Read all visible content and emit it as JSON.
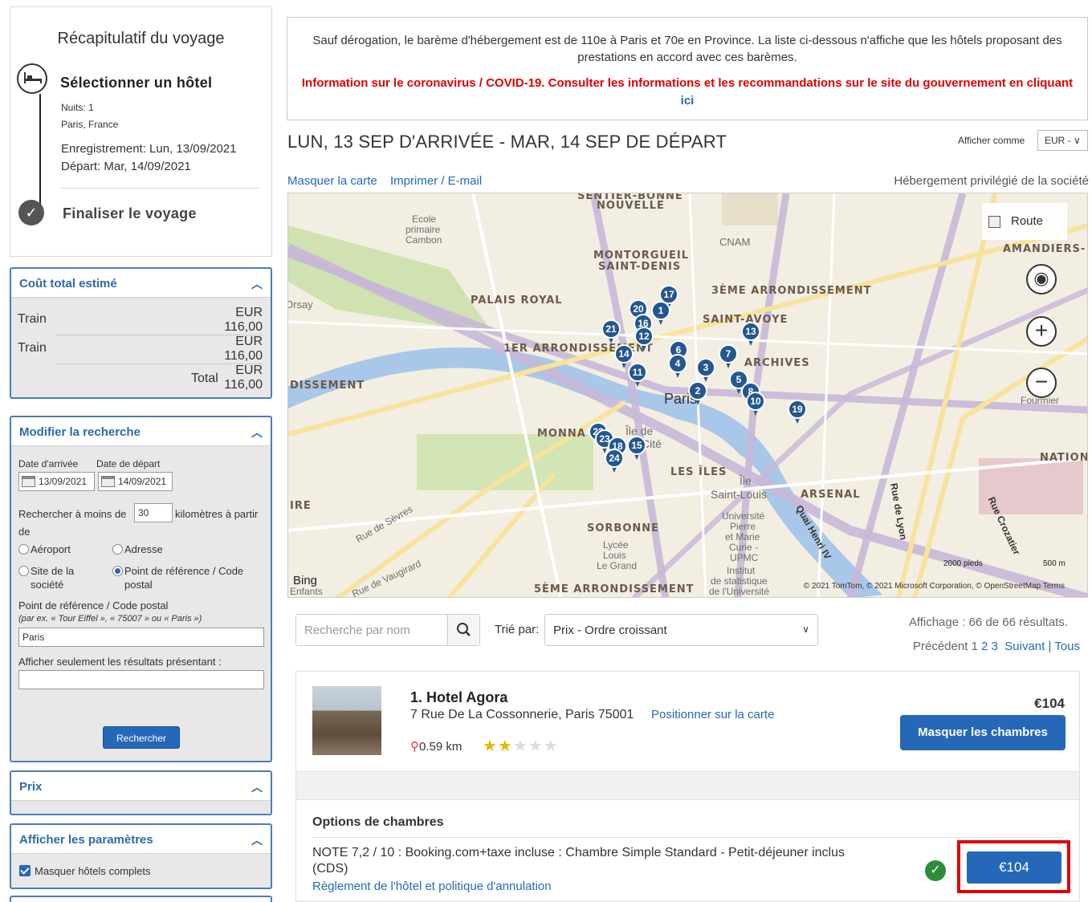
{
  "trip": {
    "title": "Récapitulatif du voyage",
    "step1": "Sélectionner un hôtel",
    "nights": "Nuits: 1",
    "city": "Paris, France",
    "checkin": "Enregistrement: Lun, 13/09/2021",
    "checkout": "Départ: Mar, 14/09/2021",
    "step2": "Finaliser le voyage"
  },
  "cost": {
    "title": "Coût total estimé",
    "rows": [
      {
        "label": "Train",
        "currency": "EUR",
        "amount": "116,00"
      },
      {
        "label": "Train",
        "currency": "EUR",
        "amount": "116,00"
      }
    ],
    "total_label": "Total",
    "total_currency": "EUR",
    "total_amount": "116,00"
  },
  "modify": {
    "title": "Modifier la recherche",
    "arrival_label": "Date d'arrivée",
    "departure_label": "Date de départ",
    "arrival_value": "13/09/2021",
    "departure_value": "14/09/2021",
    "radius_prefix": "Rechercher à moins de",
    "radius_value": "30",
    "radius_suffix": "kilomètres à partir",
    "radius_suffix2": "de",
    "opt_airport": "Aéroport",
    "opt_address": "Adresse",
    "opt_company": "Site de la",
    "opt_company2": "société",
    "opt_ref": "Point de référence / Code",
    "opt_ref2": "postal",
    "ref_label": "Point de référence / Code postal",
    "ref_example": "(par ex. « Tour Eiffel », « 75007 » ou « Paris »)",
    "ref_value": "Paris",
    "filter_label": "Afficher seulement les résultats présentant :",
    "filter_value": "",
    "search_button": "Rechercher"
  },
  "price_panel": {
    "title": "Prix"
  },
  "params_panel": {
    "title": "Afficher les paramètres",
    "hide_full": "Masquer hôtels complets"
  },
  "notice": {
    "line1": "Sauf dérogation, le barème d'hébergement est de 110e à Paris et 70e en Province. La liste ci-dessous n'affiche que les hôtels proposant des prestations en accord avec ces barèmes.",
    "covid": "Information sur le coronavirus / COVID-19. Consulter les informations et les recommandations sur le site du gouvernement en cliquant",
    "covid_link": "ici"
  },
  "header": {
    "dates": "LUN, 13 SEP D'ARRIVÉE - MAR, 14 SEP DE DÉPART",
    "display_as": "Afficher comme",
    "currency": "EUR - ∨",
    "hide_map": "Masquer la carte",
    "print": "Imprimer / E-mail",
    "preferred": "Hébergement privilégié de la société"
  },
  "map": {
    "route_label": "Route",
    "labels": {
      "saint_bonne": "SENTIER-BONNE",
      "nouvelle": "NOUVELLE",
      "ecole": "Ecole",
      "primaire": "primaire",
      "cambon": "Cambon",
      "cnam": "CNAM",
      "amandiers": "AMANDIERS-",
      "montorgueil": "MONTORGUEIL",
      "saint_denis": "SAINT-DENIS",
      "palais": "PALAIS ROYAL",
      "arr3": "3ÈME ARRONDISSEMENT",
      "orsay": "Orsay",
      "saint_avoye": "SAINT-AVOYE",
      "arr1": "1ER ARRONDISSEMENT",
      "archives": "ARCHIVES",
      "dissement": "DISSEMENT",
      "paris": "Paris",
      "monna": "MONNA",
      "ile_de": "Île de",
      "cite": "Cité",
      "nation": "NATION",
      "les_iles": "LES ÎLES",
      "ile": "Île",
      "saint_louis": "Saint-Louis",
      "arsenal": "ARSENAL",
      "ire": "IRE",
      "sorbonne": "SORBONNE",
      "arr5": "5ÈME ARRONDISSEMENT",
      "rue_sevres": "Rue de Sèvres",
      "rue_vaugirard": "Rue de Vaugirard",
      "quai": "Quai Henri IV",
      "rue_lyon": "Rue de Lyon",
      "rue_crozatier": "Rue Crozatier",
      "lycee": "Lycée",
      "louis": "Louis",
      "le_grand": "Le Grand",
      "universite": "Université",
      "pierre": "Pierre",
      "et_marie": "et Marie",
      "curie": "Curie -",
      "upmc": "UPMC",
      "institut": "Institut",
      "de_stat": "de statistique",
      "de_univ": "de l'Université",
      "fourmier": "Fourmier",
      "enfants": "Enfants"
    },
    "pins": [
      "17",
      "20",
      "1",
      "16",
      "21",
      "12",
      "13",
      "14",
      "6",
      "7",
      "4",
      "3",
      "11",
      "5",
      "8",
      "10",
      "2",
      "19",
      "22",
      "23",
      "18",
      "15",
      "24"
    ],
    "scale_feet": "2000 pieds",
    "scale_m": "500 m",
    "bing": "Bing",
    "copyright": "© 2021 TomTom, © 2021 Microsoft Corporation, © OpenStreetMap  Terms",
    "controls": {
      "locate": "◉",
      "zoom_in": "+",
      "zoom_out": "−"
    }
  },
  "search_row": {
    "name_placeholder": "Recherche par nom",
    "sort_label": "Trié par:",
    "sort_value": "Prix - Ordre croissant",
    "results": "Affichage : 66 de 66 résultats.",
    "prev": "Précédent",
    "p1": "1",
    "p2": "2",
    "p3": "3",
    "next": "Suivant",
    "sep": "|",
    "all": "Tous"
  },
  "hotel": {
    "name": "1. Hotel Agora",
    "address": "7 Rue De La Cossonnerie, Paris 75001",
    "map_link": "Positionner sur la carte",
    "distance": "0.59 km",
    "rating": 2,
    "price": "€104",
    "rooms_button": "Masquer les chambres",
    "options_title": "Options de chambres",
    "room_desc": "NOTE 7,2 / 10 : Booking.com+taxe incluse : Chambre Simple Standard - Petit-déjeuner inclus (CDS)",
    "policy_link": "Règlement de l'hôtel et politique d'annulation",
    "room_price": "€104"
  }
}
